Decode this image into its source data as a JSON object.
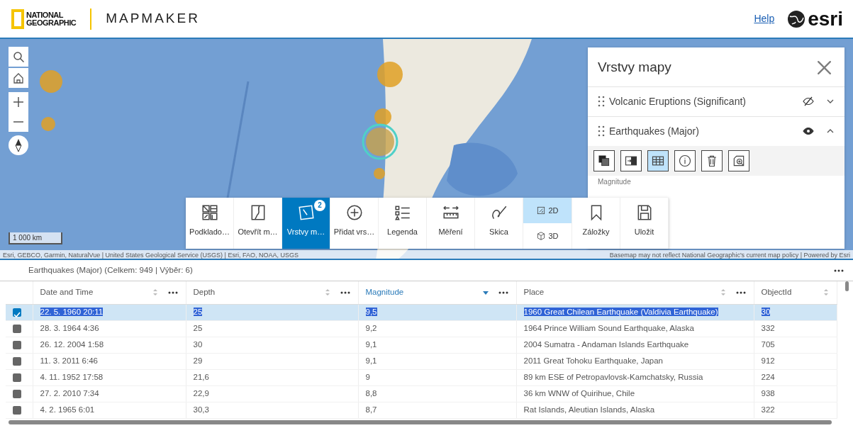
{
  "header": {
    "logo_lines": [
      "NATIONAL",
      "GEOGRAPHIC"
    ],
    "app_title": "MAPMAKER",
    "help_link": "Help",
    "brand": "esri"
  },
  "map": {
    "kind": "picture",
    "scale": "1 000 km",
    "attribution_left": "Esri, GEBCO, Garmin, NaturalVue | United States Geological Service (USGS) | Esri, FAO, NOAA, USGS",
    "attribution_right": "Basemap may not reflect National Geographic's current map policy | Powered by Esri"
  },
  "layers_panel": {
    "title": "Vrstvy mapy",
    "layers": [
      {
        "name": "Volcanic Eruptions (Significant)",
        "visible": false,
        "expanded": false
      },
      {
        "name": "Earthquakes (Major)",
        "visible": true,
        "expanded": true
      }
    ],
    "actions": [
      {
        "kind": "arrange",
        "selected": false
      },
      {
        "kind": "transfer",
        "selected": false
      },
      {
        "kind": "table",
        "selected": true
      },
      {
        "kind": "info",
        "selected": false
      },
      {
        "kind": "delete",
        "selected": false
      },
      {
        "kind": "zoom",
        "selected": false
      }
    ],
    "field_label": "Magnitude"
  },
  "toolbar": [
    {
      "kind": "basemap",
      "label": "Podklado…",
      "selected": false
    },
    {
      "kind": "open",
      "label": "Otevřít m…",
      "selected": false
    },
    {
      "kind": "layers",
      "label": "Vrstvy m…",
      "selected": true,
      "badge": "2"
    },
    {
      "kind": "add",
      "label": "Přidat vrs…",
      "selected": false
    },
    {
      "kind": "legend",
      "label": "Legenda",
      "selected": false
    },
    {
      "kind": "measure",
      "label": "Měření",
      "selected": false
    },
    {
      "kind": "sketch",
      "label": "Skica",
      "selected": false
    },
    {
      "kind": "view",
      "options": [
        {
          "label": "2D",
          "selected": true
        },
        {
          "label": "3D",
          "selected": false
        }
      ]
    },
    {
      "kind": "bookmarks",
      "label": "Záložky",
      "selected": false
    },
    {
      "kind": "save",
      "label": "Uložit",
      "selected": false
    }
  ],
  "table": {
    "title": "Earthquakes (Major) (Celkem: 949 | Výběr: 6)",
    "columns": [
      {
        "label": "Date and Time",
        "sorted": false
      },
      {
        "label": "Depth",
        "sorted": false
      },
      {
        "label": "Magnitude",
        "sorted": true
      },
      {
        "label": "Place",
        "sorted": false
      },
      {
        "label": "ObjectId",
        "sorted": false
      }
    ],
    "rows": [
      {
        "selected": true,
        "cells": [
          "22. 5. 1960 20:11",
          "25",
          "9,5",
          "1960 Great Chilean Earthquake (Valdivia Earthquake)",
          "30"
        ]
      },
      {
        "selected": false,
        "cells": [
          "28. 3. 1964 4:36",
          "25",
          "9,2",
          "1964 Prince William Sound Earthquake, Alaska",
          "332"
        ]
      },
      {
        "selected": false,
        "cells": [
          "26. 12. 2004 1:58",
          "30",
          "9,1",
          "2004 Sumatra - Andaman Islands Earthquake",
          "705"
        ]
      },
      {
        "selected": false,
        "cells": [
          "11. 3. 2011 6:46",
          "29",
          "9,1",
          "2011 Great Tohoku Earthquake, Japan",
          "912"
        ]
      },
      {
        "selected": false,
        "cells": [
          "4. 11. 1952 17:58",
          "21,6",
          "9",
          "89 km ESE of Petropavlovsk-Kamchatsky, Russia",
          "224"
        ]
      },
      {
        "selected": false,
        "cells": [
          "27. 2. 2010 7:34",
          "22,9",
          "8,8",
          "36 km WNW of Quirihue, Chile",
          "938"
        ]
      },
      {
        "selected": false,
        "cells": [
          "4. 2. 1965 6:01",
          "30,3",
          "8,7",
          "Rat Islands, Aleutian Islands, Alaska",
          "322"
        ]
      }
    ]
  }
}
